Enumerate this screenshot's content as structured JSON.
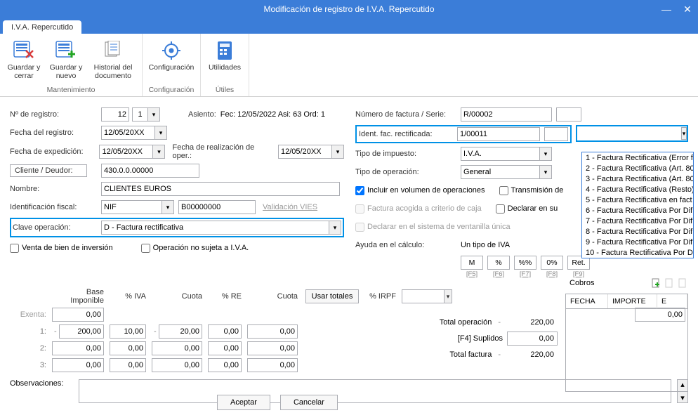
{
  "window": {
    "title": "Modificación de registro de I.V.A. Repercutido"
  },
  "tab": {
    "label": "I.V.A. Repercutido"
  },
  "ribbon": {
    "groups": {
      "mantenimiento": {
        "label": "Mantenimiento",
        "save_close": "Guardar y cerrar",
        "save_new": "Guardar y nuevo",
        "history": "Historial del documento"
      },
      "configuracion": {
        "label": "Configuración",
        "config": "Configuración"
      },
      "utiles": {
        "label": "Útiles",
        "utilities": "Utilidades"
      }
    }
  },
  "left": {
    "n_registro_lbl": "Nº de registro:",
    "n_registro_val": "12",
    "n_registro_sub": "1",
    "asiento_lbl": "Asiento:",
    "asiento_text": "Fec: 12/05/2022 Asi: 63 Ord: 1",
    "fecha_registro_lbl": "Fecha del registro:",
    "fecha_registro_val": "12/05/20XX",
    "fecha_exp_lbl": "Fecha de expedición:",
    "fecha_exp_val": "12/05/20XX",
    "fecha_real_lbl": "Fecha de realización de oper.:",
    "fecha_real_val": "12/05/20XX",
    "cliente_lbl": "Cliente / Deudor:",
    "cliente_val": "430.0.0.00000",
    "nombre_lbl": "Nombre:",
    "nombre_val": "CLIENTES EUROS",
    "id_fiscal_lbl": "Identificación fiscal:",
    "id_fiscal_type": "NIF",
    "id_fiscal_val": "B00000000",
    "validacion_vies": "Validación VIES",
    "clave_op_lbl": "Clave operación:",
    "clave_op_val": "D - Factura rectificativa",
    "venta_bien": "Venta de bien de inversión",
    "op_no_sujeta": "Operación no sujeta a I.V.A."
  },
  "right": {
    "num_factura_lbl": "Número de factura / Serie:",
    "num_factura_val": "R/00002",
    "ident_rect_lbl": "Ident. fac. rectificada:",
    "ident_rect_val": "1/00011",
    "tipo_imp_lbl": "Tipo de impuesto:",
    "tipo_imp_val": "I.V.A.",
    "tipo_op_lbl": "Tipo de operación:",
    "tipo_op_val": "General",
    "incluir_vol": "Incluir en volumen de operaciones",
    "transmision": "Transmisión de",
    "factura_caja": "Factura acogida a criterio de caja",
    "declarar_su": "Declarar en su",
    "declarar_vent": "Declarar en el sistema de ventanilla única",
    "ayuda_calc_lbl": "Ayuda en el cálculo:",
    "ayuda_calc_val": "Un tipo de IVA",
    "calc_buttons": {
      "m": "M",
      "pct": "%",
      "pctpct": "%%",
      "pct0": "0%",
      "ret": "Ret."
    },
    "calc_hints": {
      "m": "[F5]",
      "pct": "[F6]",
      "pctpct": "[F7]",
      "pct0": "[F8]",
      "ret": "[F9]"
    }
  },
  "dropdown_options": [
    "1 - Factura Rectificativa (Error f",
    "2 - Factura Rectificativa (Art. 80",
    "3 - Factura Rectificativa (Art. 80",
    "4 - Factura Rectificativa (Resto)",
    "5 - Factura Rectificativa en fact",
    "6 - Factura Rectificativa Por Dif",
    "7 - Factura Rectificativa Por Dif",
    "8 - Factura Rectificativa Por Dif",
    "9 - Factura Rectificativa Por Dif",
    "10 - Factura Rectificativa Por D"
  ],
  "table": {
    "headers": {
      "base": "Base Imponible",
      "pct_iva": "% IVA",
      "cuota": "Cuota",
      "pct_re": "% RE",
      "cuota2": "Cuota",
      "usar_totales": "Usar totales",
      "pct_irpf": "% IRPF"
    },
    "rows": {
      "exenta_lbl": "Exenta:",
      "exenta_base": "0,00",
      "r1_lbl": "1:",
      "r1": {
        "base": "200,00",
        "pct": "10,00",
        "cuota": "20,00",
        "re": "0,00",
        "cuota2": "0,00"
      },
      "r2_lbl": "2:",
      "r2": {
        "base": "0,00",
        "pct": "0,00",
        "cuota": "0,00",
        "re": "0,00",
        "cuota2": "0,00"
      },
      "r3_lbl": "3:",
      "r3": {
        "base": "0,00",
        "pct": "0,00",
        "cuota": "0,00",
        "re": "0,00",
        "cuota2": "0,00"
      },
      "irpf_base": "0,00"
    }
  },
  "totals": {
    "total_op_lbl": "Total operación",
    "total_op_val": "220,00",
    "suplidos_lbl": "[F4] Suplidos",
    "suplidos_val": "0,00",
    "total_fact_lbl": "Total factura",
    "total_fact_val": "220,00"
  },
  "obs_lbl": "Observaciones:",
  "cobros": {
    "title": "Cobros",
    "fecha": "FECHA",
    "importe": "IMPORTE",
    "e": "E"
  },
  "actions": {
    "accept": "Aceptar",
    "cancel": "Cancelar"
  }
}
